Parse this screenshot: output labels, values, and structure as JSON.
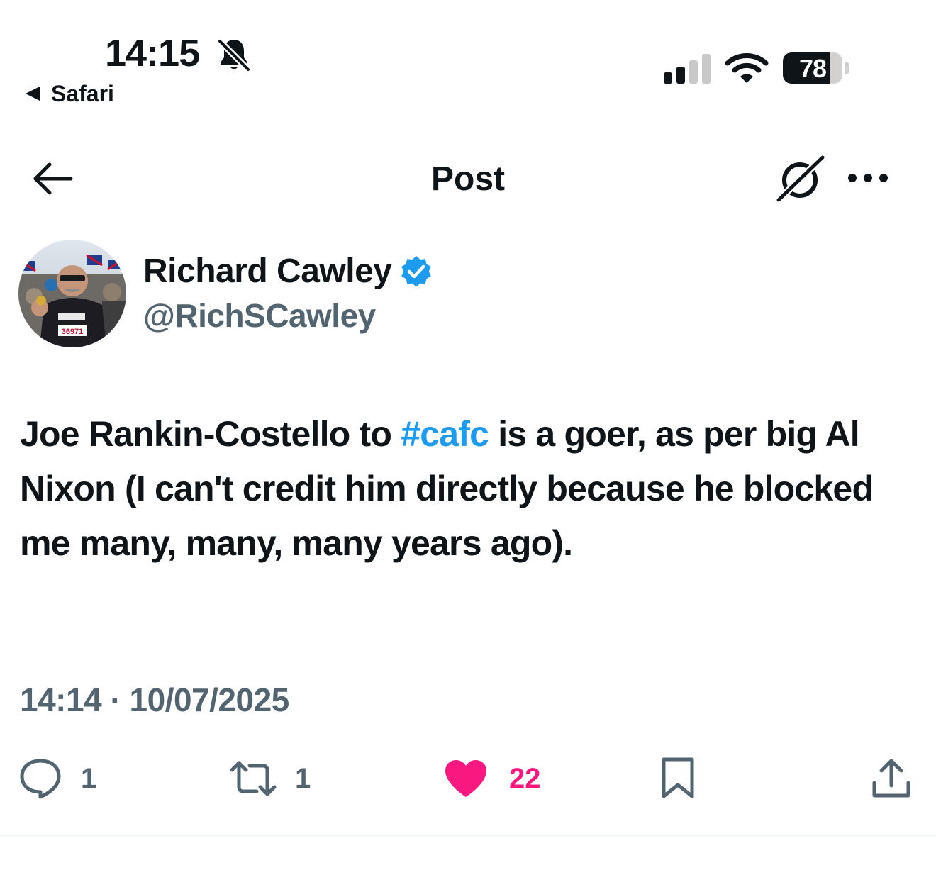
{
  "status_bar": {
    "time": "14:15",
    "back_app": "Safari",
    "battery_percent": "78",
    "battery_level": 0.78,
    "icons": [
      "bell-slash-icon",
      "cellular-signal-icon",
      "wifi-icon",
      "battery-icon"
    ]
  },
  "header": {
    "title": "Post",
    "icons": [
      "back-arrow-icon",
      "grok-icon",
      "more-icon"
    ]
  },
  "author": {
    "name": "Richard Cawley",
    "handle": "@RichSCawley",
    "verified": true,
    "verified_color": "#1d9bf0"
  },
  "tweet": {
    "text_before": "Joe Rankin-Costello to ",
    "hashtag": "#cafc",
    "text_after": " is a goer, as per big Al Nixon (I can't credit him directly because he blocked me many, many, many years ago).",
    "timestamp": "14:14 · 10/07/2025"
  },
  "actions": {
    "replies": "1",
    "reposts": "1",
    "likes": "22",
    "liked": true,
    "like_color": "#f91880",
    "icons": [
      "reply-icon",
      "repost-icon",
      "heart-icon",
      "bookmark-icon",
      "share-icon"
    ]
  },
  "colors": {
    "text": "#0f1419",
    "secondary": "#536471",
    "accent": "#1d9bf0"
  }
}
